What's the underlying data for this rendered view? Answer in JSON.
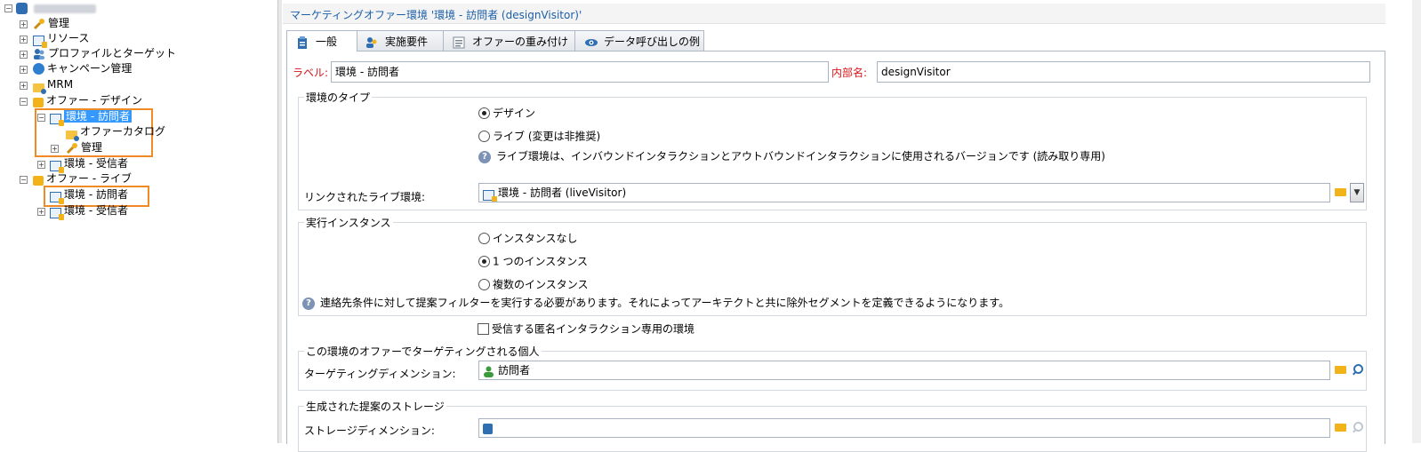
{
  "tree": {
    "root_label": "",
    "items": [
      {
        "label": "管理"
      },
      {
        "label": "リソース"
      },
      {
        "label": "プロファイルとターゲット"
      },
      {
        "label": "キャンペーン管理"
      },
      {
        "label": "MRM"
      },
      {
        "label": "オファー - デザイン"
      },
      {
        "label": "環境 - 訪問者"
      },
      {
        "label": "オファーカタログ"
      },
      {
        "label": "管理"
      },
      {
        "label": "環境 - 受信者"
      },
      {
        "label": "オファー - ライブ"
      },
      {
        "label": "環境 - 訪問者"
      },
      {
        "label": "環境 - 受信者"
      }
    ]
  },
  "header": {
    "title": "マーケティングオファー環境 '環境 - 訪問者 (designVisitor)'"
  },
  "tabs": [
    {
      "label": "一般"
    },
    {
      "label": "実施要件"
    },
    {
      "label": "オファーの重み付け"
    },
    {
      "label": "データ呼び出しの例"
    }
  ],
  "form": {
    "label_caption": "ラベル:",
    "label_value": "環境 - 訪問者",
    "internal_caption": "内部名:",
    "internal_value": "designVisitor",
    "env_type": {
      "title": "環境のタイプ",
      "option_design": "デザイン",
      "option_live": "ライブ (変更は非推奨)",
      "info": "ライブ環境は、インバウンドインタラクションとアウトバウンドインタラクションに使用されるバージョンです (読み取り専用)",
      "linked_caption": "リンクされたライブ環境:",
      "linked_value": "環境 - 訪問者 (liveVisitor)"
    },
    "instance": {
      "title": "実行インスタンス",
      "option_none": "インスタンスなし",
      "option_one": "1 つのインスタンス",
      "option_multi": "複数のインスタンス",
      "info": "連絡先条件に対して提案フィルターを実行する必要があります。それによってアーキテクトと共に除外セグメントを定義できるようになります。"
    },
    "anon_check": "受信する匿名インタラクション専用の環境",
    "targeting": {
      "title": "この環境のオファーでターゲティングされる個人",
      "caption": "ターゲティングディメンション:",
      "value": "訪問者"
    },
    "storage": {
      "title": "生成された提案のストレージ",
      "caption": "ストレージディメンション:",
      "value": ""
    }
  },
  "colors": {
    "accent": "#3399ff",
    "highlight": "#f08a24",
    "title_blue": "#1c5fa8",
    "required_red": "#d8161a"
  }
}
